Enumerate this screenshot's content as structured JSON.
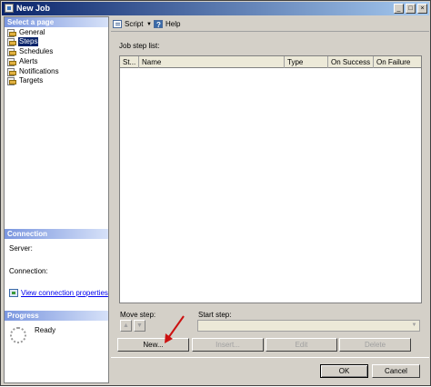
{
  "window": {
    "title": "New Job",
    "controls": [
      "_",
      "□",
      "×"
    ]
  },
  "left_panel": {
    "select_page_header": "Select a page",
    "pages": [
      {
        "label": "General",
        "selected": false
      },
      {
        "label": "Steps",
        "selected": true
      },
      {
        "label": "Schedules",
        "selected": false
      },
      {
        "label": "Alerts",
        "selected": false
      },
      {
        "label": "Notifications",
        "selected": false
      },
      {
        "label": "Targets",
        "selected": false
      }
    ],
    "connection_header": "Connection",
    "server_label": "Server:",
    "connection_label": "Connection:",
    "view_connection_link": "View connection properties",
    "progress_header": "Progress",
    "progress_status": "Ready"
  },
  "toolbar": {
    "script_label": "Script",
    "help_label": "Help"
  },
  "main": {
    "job_step_list_label": "Job step list:",
    "columns": [
      "St...",
      "Name",
      "Type",
      "On Success",
      "On Failure"
    ],
    "move_step_label": "Move step:",
    "start_step_label": "Start step:",
    "buttons": {
      "new": "New...",
      "insert": "Insert...",
      "edit": "Edit",
      "delete": "Delete"
    }
  },
  "footer": {
    "ok": "OK",
    "cancel": "Cancel"
  },
  "colors": {
    "title_bar": "#0a246a",
    "selected_item": "#0a246a",
    "annotation_arrow": "#cc1111"
  }
}
